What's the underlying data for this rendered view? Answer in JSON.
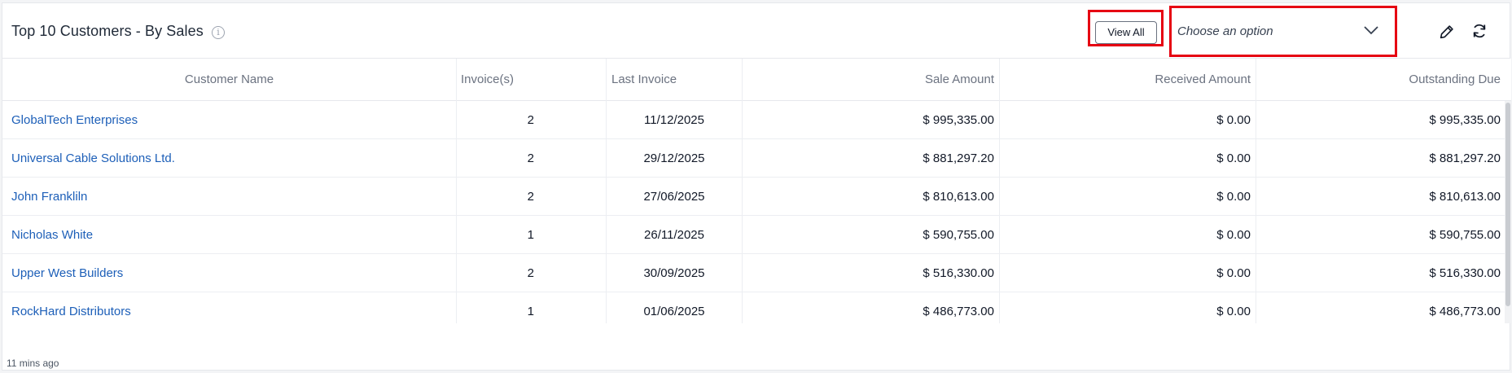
{
  "widget": {
    "title": "Top 10 Customers - By Sales",
    "view_all_label": "View All",
    "select_placeholder": "Choose an option",
    "updated_text": "11 mins ago",
    "highlight_color": "#e60012",
    "link_color": "#1d5fb8",
    "icons": {
      "info": "info-icon",
      "select": "chevron-down-icon",
      "edit": "pencil-icon",
      "refresh": "refresh-icon"
    }
  },
  "table": {
    "columns": [
      "Customer Name",
      "Invoice(s)",
      "Last Invoice",
      "Sale Amount",
      "Received Amount",
      "Outstanding Due"
    ],
    "rows": [
      [
        "GlobalTech Enterprises",
        "2",
        "11/12/2025",
        "$ 995,335.00",
        "$ 0.00",
        "$ 995,335.00"
      ],
      [
        "Universal Cable Solutions Ltd.",
        "2",
        "29/12/2025",
        "$ 881,297.20",
        "$ 0.00",
        "$ 881,297.20"
      ],
      [
        "John Frankliln",
        "2",
        "27/06/2025",
        "$ 810,613.00",
        "$ 0.00",
        "$ 810,613.00"
      ],
      [
        "Nicholas White",
        "1",
        "26/11/2025",
        "$ 590,755.00",
        "$ 0.00",
        "$ 590,755.00"
      ],
      [
        "Upper West Builders",
        "2",
        "30/09/2025",
        "$ 516,330.00",
        "$ 0.00",
        "$ 516,330.00"
      ],
      [
        "RockHard Distributors",
        "1",
        "01/06/2025",
        "$ 486,773.00",
        "$ 0.00",
        "$ 486,773.00"
      ]
    ]
  }
}
